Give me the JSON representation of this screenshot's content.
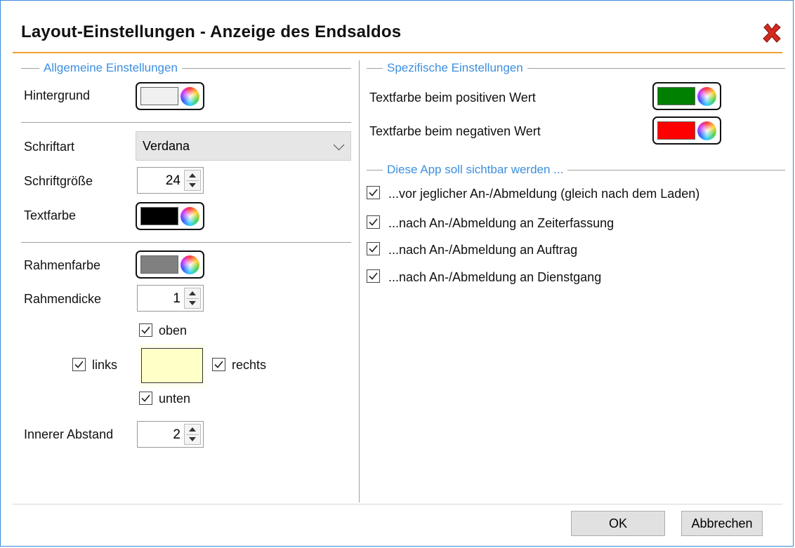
{
  "window": {
    "title": "Layout-Einstellungen - Anzeige des Endsaldos",
    "close_icon": "close-x-icon"
  },
  "general": {
    "legend": "Allgemeine Einstellungen",
    "background_label": "Hintergrund",
    "background_color": "#f0f0f0",
    "font_label": "Schriftart",
    "font_value": "Verdana",
    "font_size_label": "Schriftgröße",
    "font_size_value": "24",
    "text_color_label": "Textfarbe",
    "text_color": "#000000",
    "border_color_label": "Rahmenfarbe",
    "border_color": "#808080",
    "border_width_label": "Rahmendicke",
    "border_width_value": "1",
    "border_sides": {
      "top": "oben",
      "left": "links",
      "right": "rechts",
      "bottom": "unten"
    },
    "preview_color": "#ffffc8",
    "padding_label": "Innerer Abstand",
    "padding_value": "2"
  },
  "specific": {
    "legend": "Spezifische Einstellungen",
    "positive_label": "Textfarbe beim positiven Wert",
    "positive_color": "#008000",
    "negative_label": "Textfarbe beim negativen Wert",
    "negative_color": "#ff0000"
  },
  "visibility": {
    "legend": "Diese App soll sichtbar werden ...",
    "options": [
      {
        "label": "...vor jeglicher An-/Abmeldung (gleich nach dem Laden)",
        "checked": true
      },
      {
        "label": "...nach An-/Abmeldung an Zeiterfassung",
        "checked": true
      },
      {
        "label": "...nach An-/Abmeldung an Auftrag",
        "checked": true
      },
      {
        "label": "...nach An-/Abmeldung an Dienstgang",
        "checked": true
      }
    ]
  },
  "footer": {
    "ok_label": "OK",
    "cancel_label": "Abbrechen"
  },
  "colors": {
    "accent_orange": "#f0a030",
    "legend_blue": "#3c8fe0",
    "frame_blue": "#3c8ad6"
  }
}
